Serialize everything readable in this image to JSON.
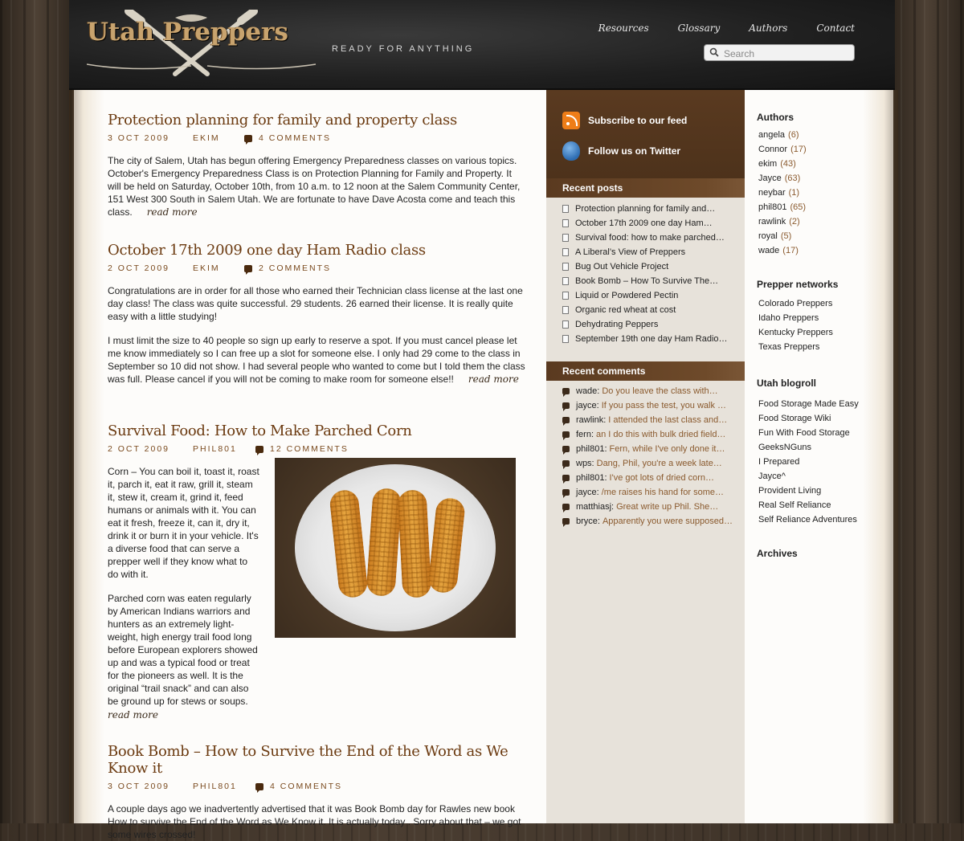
{
  "header": {
    "logo_text": "Utah Preppers",
    "tagline": "READY FOR ANYTHING",
    "nav": [
      "Resources",
      "Glossary",
      "Authors",
      "Contact"
    ],
    "search_placeholder": "Search"
  },
  "posts": [
    {
      "title": "Protection planning for family and property class",
      "date": "3 OCT 2009",
      "author": "EKIM",
      "comments": "4 COMMENTS",
      "paragraphs": [
        "The city of Salem, Utah has begun offering Emergency Preparedness classes on various topics. October's Emergency Preparedness Class is on Protection Planning for Family and Property. It will be held on Saturday, October 10th, from 10 a.m. to 12 noon at the Salem Community Center, 151 West 300 South in Salem Utah. We are fortunate to have Dave Acosta come and teach this class."
      ],
      "read_more": "read more"
    },
    {
      "title": "October 17th 2009 one day Ham Radio class",
      "date": "2 OCT 2009",
      "author": "EKIM",
      "comments": "2 COMMENTS",
      "paragraphs": [
        "Congratulations are in order for all those who earned their Technician class license at the last one day class! The class was quite successful. 29 students. 26 earned their license. It is really quite easy with a little studying!",
        "I must limit the size to 40 people so sign up early to reserve a spot. If you must cancel please let me know immediately so I can free up a slot for someone else. I only had 29 come to the class in September so 10 did not show. I had several people who wanted to come but I told them the class was full. Please cancel if you will not be coming to make room for someone else!!"
      ],
      "read_more": "read more"
    },
    {
      "title": "Survival Food: How to Make Parched Corn",
      "date": "2 OCT 2009",
      "author": "PHIL801",
      "comments": "12 COMMENTS",
      "paragraphs": [
        "Corn – You can boil it, toast it, roast it, parch it, eat it raw, grill it, steam it, stew it, cream it, grind it, feed humans or animals with it. You can eat it fresh, freeze it, can it,  dry it, drink it or burn it in your vehicle.  It's a diverse food that can serve a prepper well if they know what to do with it.",
        "Parched corn was eaten regularly by American Indians warriors and hunters as an extremely light-weight, high energy trail food long before European explorers showed up and was a typical food or treat for the pioneers as well.  It is the original “trail snack” and can also be ground up for stews or soups."
      ],
      "read_more": "read more"
    },
    {
      "title": "Book Bomb – How to Survive the End of the Word as We Know it",
      "date": "3 OCT 2009",
      "author": "PHIL801",
      "comments": "4 COMMENTS",
      "paragraphs": [
        "A couple days ago we inadvertently advertised that it was Book Bomb day for Rawles new book How to survive the End of the Word as We Know it.  It is actually today .   Sorry about that – we got some wires crossed!"
      ]
    }
  ],
  "feeds": {
    "subscribe": "Subscribe to our feed",
    "twitter": "Follow us on Twitter"
  },
  "recent_posts": {
    "title": "Recent posts",
    "items": [
      "Protection planning for family and…",
      "October 17th 2009 one day Ham…",
      "Survival food: how to make parched…",
      "A Liberal’s View of Preppers",
      "Bug Out Vehicle Project",
      "Book Bomb – How To Survive The…",
      "Liquid or Powdered Pectin",
      "Organic red wheat at cost",
      "Dehydrating Peppers",
      "September 19th one day Ham Radio…"
    ]
  },
  "recent_comments": {
    "title": "Recent comments",
    "items": [
      {
        "author": "wade:",
        "text": "Do you leave the class with…"
      },
      {
        "author": "jayce:",
        "text": "If you pass the test, you walk …"
      },
      {
        "author": "rawlink:",
        "text": "I attended the last class and…"
      },
      {
        "author": "fern:",
        "text": "an I do this with bulk dried field…"
      },
      {
        "author": "phil801:",
        "text": "Fern, while I've only done it…"
      },
      {
        "author": "wps:",
        "text": "Dang, Phil, you're a week late…"
      },
      {
        "author": "phil801:",
        "text": "I've got lots of dried corn…"
      },
      {
        "author": "jayce:",
        "text": "/me raises his hand for some…"
      },
      {
        "author": "matthiasj:",
        "text": "Great write up Phil. She…"
      },
      {
        "author": "bryce:",
        "text": "Apparently you were supposed…"
      }
    ]
  },
  "authors": {
    "title": "Authors",
    "items": [
      {
        "name": "angela",
        "count": "(6)"
      },
      {
        "name": "Connor",
        "count": "(17)"
      },
      {
        "name": "ekim",
        "count": "(43)"
      },
      {
        "name": "Jayce",
        "count": "(63)"
      },
      {
        "name": "neybar",
        "count": "(1)"
      },
      {
        "name": "phil801",
        "count": "(65)"
      },
      {
        "name": "rawlink",
        "count": "(2)"
      },
      {
        "name": "royal",
        "count": "(5)"
      },
      {
        "name": "wade",
        "count": "(17)"
      }
    ]
  },
  "networks": {
    "title": "Prepper networks",
    "items": [
      "Colorado Preppers",
      "Idaho Preppers",
      "Kentucky Preppers",
      "Texas Preppers"
    ]
  },
  "blogroll": {
    "title": "Utah blogroll",
    "items": [
      "Food Storage Made Easy",
      "Food Storage Wiki",
      "Fun With Food Storage",
      "GeeksNGuns",
      "I Prepared",
      "Jayce^",
      "Provident Living",
      "Real Self Reliance",
      "Self Reliance Adventures"
    ]
  },
  "archives": {
    "title": "Archives"
  },
  "colors": {
    "accent": "#6b3a10",
    "sidebar_brown": "#5a3a20",
    "comment_text": "#8a5a2e"
  }
}
